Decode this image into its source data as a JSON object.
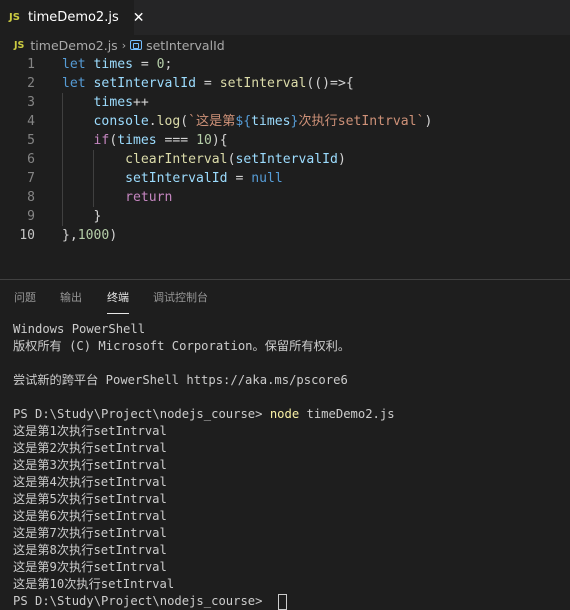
{
  "tab": {
    "badge": "JS",
    "title": "timeDemo2.js",
    "close": "✕"
  },
  "breadcrumb": {
    "badge": "JS",
    "file": "timeDemo2.js",
    "separator": "›",
    "symbol": "setIntervalId",
    "symbol_icon": "symbol-variable-icon"
  },
  "editor": {
    "line_numbers": [
      "1",
      "2",
      "3",
      "4",
      "5",
      "6",
      "7",
      "8",
      "9",
      "10"
    ],
    "lines": [
      [
        [
          "k",
          "let"
        ],
        [
          "p",
          " "
        ],
        [
          "v",
          "times"
        ],
        [
          "p",
          " = "
        ],
        [
          "n",
          "0"
        ],
        [
          "p",
          ";"
        ]
      ],
      [
        [
          "k",
          "let"
        ],
        [
          "p",
          " "
        ],
        [
          "v",
          "setIntervalId"
        ],
        [
          "p",
          " = "
        ],
        [
          "f",
          "setInterval"
        ],
        [
          "p",
          "(()=>{"
        ]
      ],
      [
        [
          "p",
          "    "
        ],
        [
          "v",
          "times"
        ],
        [
          "p",
          "++"
        ]
      ],
      [
        [
          "p",
          "    "
        ],
        [
          "v",
          "console"
        ],
        [
          "p",
          "."
        ],
        [
          "f",
          "log"
        ],
        [
          "p",
          "("
        ],
        [
          "s",
          "`这是第"
        ],
        [
          "k",
          "${"
        ],
        [
          "v",
          "times"
        ],
        [
          "k",
          "}"
        ],
        [
          "s",
          "次执行setIntrval`"
        ],
        [
          "p",
          ")"
        ]
      ],
      [
        [
          "p",
          "    "
        ],
        [
          "c",
          "if"
        ],
        [
          "p",
          "("
        ],
        [
          "v",
          "times"
        ],
        [
          "p",
          " === "
        ],
        [
          "n",
          "10"
        ],
        [
          "p",
          "){"
        ]
      ],
      [
        [
          "p",
          "        "
        ],
        [
          "f",
          "clearInterval"
        ],
        [
          "p",
          "("
        ],
        [
          "v",
          "setIntervalId"
        ],
        [
          "p",
          ")"
        ]
      ],
      [
        [
          "p",
          "        "
        ],
        [
          "v",
          "setIntervalId"
        ],
        [
          "p",
          " = "
        ],
        [
          "k",
          "null"
        ]
      ],
      [
        [
          "p",
          "        "
        ],
        [
          "c",
          "return"
        ]
      ],
      [
        [
          "p",
          "    }"
        ]
      ],
      [
        [
          "p",
          "},"
        ],
        [
          "n",
          "1000"
        ],
        [
          "p",
          ")"
        ]
      ]
    ]
  },
  "panel": {
    "tabs": [
      "问题",
      "输出",
      "终端",
      "调试控制台"
    ],
    "active_tab": "终端"
  },
  "terminal": {
    "lines": [
      "Windows PowerShell",
      "版权所有 (C) Microsoft Corporation。保留所有权利。",
      "",
      "尝试新的跨平台 PowerShell https://aka.ms/pscore6",
      "",
      "PS D:\\Study\\Project\\nodejs_course> ",
      "这是第1次执行setIntrval",
      "这是第2次执行setIntrval",
      "这是第3次执行setIntrval",
      "这是第4次执行setIntrval",
      "这是第5次执行setIntrval",
      "这是第6次执行setIntrval",
      "这是第7次执行setIntrval",
      "这是第8次执行setIntrval",
      "这是第9次执行setIntrval",
      "这是第10次执行setIntrval"
    ],
    "command_node": "node",
    "command_arg": " timeDemo2.js",
    "final_prompt": "PS D:\\Study\\Project\\nodejs_course> "
  },
  "colors": {
    "background": "#1e1e1e",
    "keyword": "#569cd6",
    "variable": "#9cdcfe",
    "function": "#dcdcaa",
    "string": "#ce9178",
    "number": "#b5cea8",
    "control": "#c586c0",
    "js_badge": "#cbcb41"
  }
}
